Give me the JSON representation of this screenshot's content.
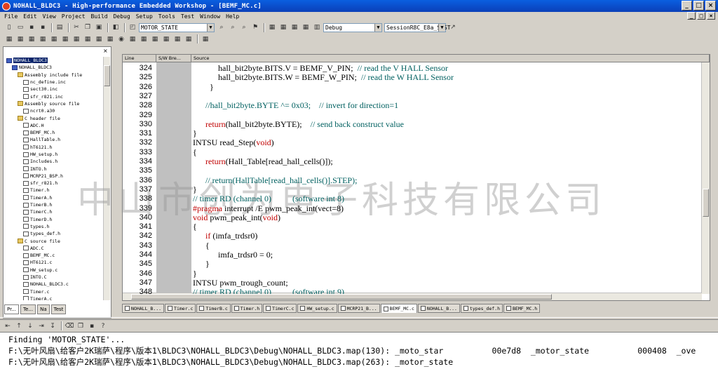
{
  "window": {
    "title": "NOHALL_BLDC3 - High-performance Embedded Workshop - [BEMF_MC.c]",
    "buttons": [
      "_",
      "□",
      "×"
    ]
  },
  "menu": {
    "items": [
      "File",
      "Edit",
      "View",
      "Project",
      "Build",
      "Debug",
      "Setup",
      "Tools",
      "Test",
      "Window",
      "Help"
    ],
    "mdi_buttons": [
      "_",
      "□",
      "×"
    ]
  },
  "toolbar": {
    "search_combo": "MOTOR_STATE",
    "config_combo": "Debug",
    "session_combo": "SessionR8C_E8a_SYST"
  },
  "tree": {
    "items": [
      {
        "label": "NOHALL_BLDC3",
        "indent": 0,
        "kind": "proj",
        "selected": true
      },
      {
        "label": "NOHALL_BLDC3",
        "indent": 1,
        "kind": "proj",
        "selected": false
      },
      {
        "label": "Assembly include file",
        "indent": 2,
        "kind": "folder",
        "selected": false
      },
      {
        "label": "nc_define.inc",
        "indent": 3,
        "kind": "file",
        "selected": false
      },
      {
        "label": "sect30.inc",
        "indent": 3,
        "kind": "file",
        "selected": false
      },
      {
        "label": "sfr_r821.inc",
        "indent": 3,
        "kind": "file",
        "selected": false
      },
      {
        "label": "Assembly source file",
        "indent": 2,
        "kind": "folder",
        "selected": false
      },
      {
        "label": "ncrt0.a30",
        "indent": 3,
        "kind": "file",
        "selected": false
      },
      {
        "label": "C header file",
        "indent": 2,
        "kind": "folder",
        "selected": false
      },
      {
        "label": "ADC.H",
        "indent": 3,
        "kind": "file",
        "selected": false
      },
      {
        "label": "BEMF_MC.h",
        "indent": 3,
        "kind": "file",
        "selected": false
      },
      {
        "label": "HallTable.h",
        "indent": 3,
        "kind": "file",
        "selected": false
      },
      {
        "label": "hT6121.h",
        "indent": 3,
        "kind": "file",
        "selected": false
      },
      {
        "label": "HW_setup.h",
        "indent": 3,
        "kind": "file",
        "selected": false
      },
      {
        "label": "Includes.h",
        "indent": 3,
        "kind": "file",
        "selected": false
      },
      {
        "label": "INTO.h",
        "indent": 3,
        "kind": "file",
        "selected": false
      },
      {
        "label": "MCRP21_BSP.h",
        "indent": 3,
        "kind": "file",
        "selected": false
      },
      {
        "label": "sfr_r821.h",
        "indent": 3,
        "kind": "file",
        "selected": false
      },
      {
        "label": "Timer.h",
        "indent": 3,
        "kind": "file",
        "selected": false
      },
      {
        "label": "TimerA.h",
        "indent": 3,
        "kind": "file",
        "selected": false
      },
      {
        "label": "TimerB.h",
        "indent": 3,
        "kind": "file",
        "selected": false
      },
      {
        "label": "TimerC.h",
        "indent": 3,
        "kind": "file",
        "selected": false
      },
      {
        "label": "TimerD.h",
        "indent": 3,
        "kind": "file",
        "selected": false
      },
      {
        "label": "types.h",
        "indent": 3,
        "kind": "file",
        "selected": false
      },
      {
        "label": "types_def.h",
        "indent": 3,
        "kind": "file",
        "selected": false
      },
      {
        "label": "C source file",
        "indent": 2,
        "kind": "folder",
        "selected": false
      },
      {
        "label": "ADC.C",
        "indent": 3,
        "kind": "file",
        "selected": false
      },
      {
        "label": "BEMF_MC.c",
        "indent": 3,
        "kind": "file",
        "selected": false
      },
      {
        "label": "HT6121.c",
        "indent": 3,
        "kind": "file",
        "selected": false
      },
      {
        "label": "HW_setup.c",
        "indent": 3,
        "kind": "file",
        "selected": false
      },
      {
        "label": "INTO.C",
        "indent": 3,
        "kind": "file",
        "selected": false
      },
      {
        "label": "NOHALL_BLDC3.c",
        "indent": 3,
        "kind": "file",
        "selected": false
      },
      {
        "label": "Timer.c",
        "indent": 3,
        "kind": "file",
        "selected": false
      },
      {
        "label": "TimerA.c",
        "indent": 3,
        "kind": "file",
        "selected": false
      }
    ]
  },
  "left_tabs": [
    "Pr...",
    "Te...",
    "Na",
    "Test"
  ],
  "editor": {
    "columns": [
      "Line",
      "S/W Bre...",
      "Source"
    ],
    "lines": [
      {
        "n": "324",
        "segs": [
          [
            "",
            "            hall_bit2byte.BITS.V = BEMF_V_PIN;  "
          ],
          [
            "cm",
            "// read the V HALL Sensor"
          ]
        ]
      },
      {
        "n": "325",
        "segs": [
          [
            "",
            "            hall_bit2byte.BITS.W = BEMF_W_PIN;  "
          ],
          [
            "cm",
            "// read the W HALL Sensor"
          ]
        ]
      },
      {
        "n": "326",
        "segs": [
          [
            "",
            "        }"
          ]
        ]
      },
      {
        "n": "327",
        "segs": [
          [
            "",
            ""
          ]
        ]
      },
      {
        "n": "328",
        "segs": [
          [
            "cm",
            "      //hall_bit2byte.BYTE ^= 0x03;    // invert for direction=1"
          ]
        ]
      },
      {
        "n": "329",
        "segs": [
          [
            "",
            ""
          ]
        ]
      },
      {
        "n": "330",
        "segs": [
          [
            "kw",
            "      return"
          ],
          [
            "",
            "(hall_bit2byte.BYTE);    "
          ],
          [
            "cm",
            "// send back construct value"
          ]
        ]
      },
      {
        "n": "331",
        "segs": [
          [
            "",
            "}"
          ]
        ]
      },
      {
        "n": "332",
        "segs": [
          [
            "",
            "INTSU read_Step("
          ],
          [
            "kw",
            "void"
          ],
          [
            "",
            ")"
          ]
        ]
      },
      {
        "n": "333",
        "segs": [
          [
            "",
            "{"
          ]
        ]
      },
      {
        "n": "334",
        "segs": [
          [
            "kw",
            "      return"
          ],
          [
            "",
            "(Hall_Table[read_hall_cells()]);"
          ]
        ]
      },
      {
        "n": "335",
        "segs": [
          [
            "",
            ""
          ]
        ]
      },
      {
        "n": "336",
        "segs": [
          [
            "cm",
            "      // return(HallTable[read_hall_cells()].STEP);"
          ]
        ]
      },
      {
        "n": "337",
        "segs": [
          [
            "",
            "}"
          ]
        ]
      },
      {
        "n": "338",
        "segs": [
          [
            "cm",
            "// timer RD (channel 0)          (software int 8)"
          ]
        ]
      },
      {
        "n": "339",
        "segs": [
          [
            "kw",
            "#pragma"
          ],
          [
            "",
            " interrupt /E pwm_peak_int(vect=8)"
          ]
        ]
      },
      {
        "n": "340",
        "segs": [
          [
            "kw",
            "void"
          ],
          [
            "",
            " pwm_peak_int("
          ],
          [
            "kw",
            "void"
          ],
          [
            "",
            ")"
          ]
        ]
      },
      {
        "n": "341",
        "segs": [
          [
            "",
            "{"
          ]
        ]
      },
      {
        "n": "342",
        "segs": [
          [
            "kw",
            "      if"
          ],
          [
            "",
            " (imfa_trdsr0)"
          ]
        ]
      },
      {
        "n": "343",
        "segs": [
          [
            "",
            "      {"
          ]
        ]
      },
      {
        "n": "344",
        "segs": [
          [
            "",
            "            imfa_trdsr0 = 0;"
          ]
        ]
      },
      {
        "n": "345",
        "segs": [
          [
            "",
            "      }"
          ]
        ]
      },
      {
        "n": "346",
        "segs": [
          [
            "",
            "}"
          ]
        ]
      },
      {
        "n": "347",
        "segs": [
          [
            "",
            "INTSU pwm_trough_count;"
          ]
        ]
      },
      {
        "n": "348",
        "segs": [
          [
            "cm",
            "// timer RD (channel 0)          (software int 9)"
          ]
        ]
      }
    ]
  },
  "watermark": "中山市创为电子科技有限公司",
  "file_tabs": [
    {
      "label": "NOHALL_B...",
      "active": false
    },
    {
      "label": "Timer.c",
      "active": false
    },
    {
      "label": "TimerB.c",
      "active": false
    },
    {
      "label": "Timer.h",
      "active": false
    },
    {
      "label": "TimerC.c",
      "active": false
    },
    {
      "label": "HW_setup.c",
      "active": false
    },
    {
      "label": "MCRP21_B...",
      "active": false
    },
    {
      "label": "BEMF_MC.c",
      "active": true
    },
    {
      "label": "NOHALL_B...",
      "active": false
    },
    {
      "label": "types_def.h",
      "active": false
    },
    {
      "label": "BEMF_MC.h",
      "active": false
    }
  ],
  "output": {
    "lines": [
      "Finding 'MOTOR_STATE'...",
      "F:\\无叶风扇\\给客户2K瑞萨\\程序\\版本1\\BLDC3\\NOHALL_BLDC3\\Debug\\NOHALL_BLDC3.map(130): _moto_star          00e7d8  _motor_state          000408  _ove",
      "F:\\无叶风扇\\给客户2K瑞萨\\程序\\版本1\\BLDC3\\NOHALL_BLDC3\\Debug\\NOHALL_BLDC3.map(263): _motor_state"
    ]
  }
}
